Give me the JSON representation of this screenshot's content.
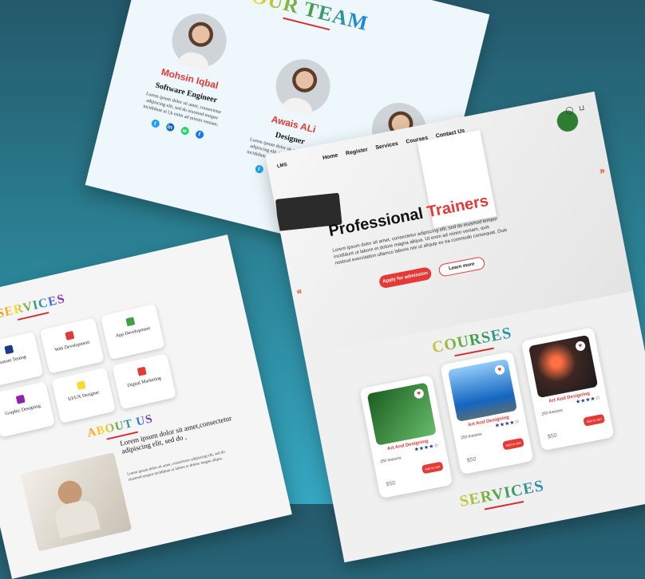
{
  "team": {
    "title": "OUR TEAM",
    "members": [
      {
        "name": "Mohsin Iqbal",
        "role": "Software Engineer",
        "desc": "Lorem ipsum dolor sit amet, consectetur adipiscing elit, sed do eiusmod tempor incididunt ut l,k enim ad minim veniam,"
      },
      {
        "name": "Awais ALi",
        "role": "Designer",
        "desc": "Lorem ipsum dolor sit amet, consectetur adipiscing elit, sed do eiusmod tempor incididunt ut l,k enim ad minim veniam,"
      }
    ]
  },
  "services": {
    "title": "SERVICES",
    "items": [
      "Custom Testing",
      "Web Development",
      "App Development",
      "Graphic Designing",
      "UI/UX Designer",
      "Digital Marketing"
    ],
    "about_title": "ABOUT US",
    "about_heading": "Lorem ipsum dolor sit amet,consectetur adipiscing elit, sed do ,",
    "about_text": "Lorem ipsum dolor sit amet, consectetur adipiscing elit, sed do eiusmod tempor incididunt ut labore et dolore magna aliqua."
  },
  "lms": {
    "logo": "LMS",
    "nav": [
      "Home",
      "Register",
      "Services",
      "Courses",
      "Contact Us"
    ],
    "hero_title_a": "Professional",
    "hero_title_b": "Trainers",
    "hero_text": "Lorem ipsum dolor sit amet, consectetur adipiscing elit, sed do eiusmod tempor incididunt ut labore et dolore magna aliqua. Ut enim ad minim veniam, quis nostrud exercitation ullamco laboris nisi ut aliquip ex ea commodo consequat. Duis",
    "apply_btn": "Apply for admission",
    "learn_btn": "Learn more",
    "courses_title": "COURSES",
    "courses": [
      {
        "title": "Art And Designing",
        "lessons": "250 lessons",
        "price": "$50",
        "stars": "★★★★☆",
        "btn": "Add to cart"
      },
      {
        "title": "Art And Designing",
        "lessons": "250 lessons",
        "price": "$50",
        "stars": "★★★★☆",
        "btn": "Add to cart"
      },
      {
        "title": "Art And Designing",
        "lessons": "250 lessons",
        "price": "$50",
        "stars": "★★★★☆",
        "btn": "Add to cart"
      }
    ],
    "services_title": "SERVICES"
  },
  "colors": {
    "accent": "#e53935",
    "bg_top": "#24596b",
    "bg_bottom": "#35a6c1",
    "twitter": "#1da1f2",
    "linkedin": "#0a66c2",
    "whatsapp": "#25d366",
    "facebook": "#1877f2"
  }
}
